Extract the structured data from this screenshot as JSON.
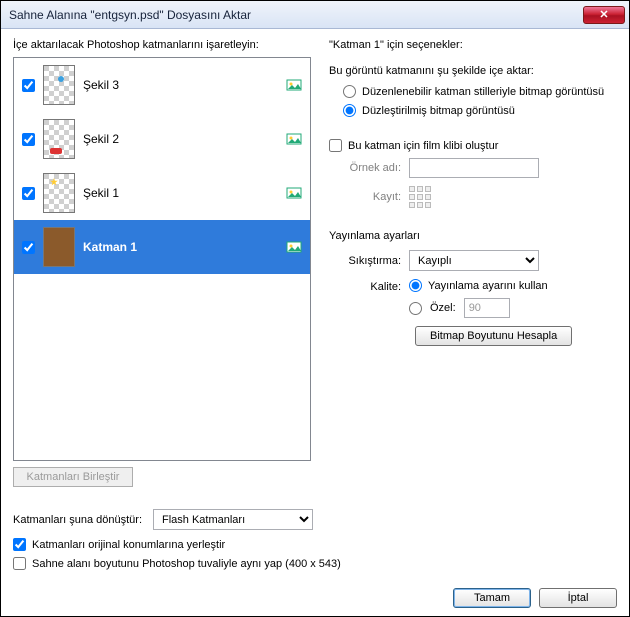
{
  "title": "Sahne Alanına \"entgsyn.psd\" Dosyasını Aktar",
  "left": {
    "heading": "İçe aktarılacak Photoshop katmanlarını işaretleyin:",
    "layers": [
      {
        "name": "Şekil 3",
        "checked": true,
        "selected": false
      },
      {
        "name": "Şekil 2",
        "checked": true,
        "selected": false
      },
      {
        "name": "Şekil 1",
        "checked": true,
        "selected": false
      },
      {
        "name": "Katman 1",
        "checked": true,
        "selected": true
      }
    ],
    "merge_btn": "Katmanları Birleştir"
  },
  "right": {
    "options_for": "\"Katman 1\" için seçenekler:",
    "import_as": {
      "heading": "Bu görüntü katmanını şu şekilde içe aktar:",
      "opt_editable": "Düzenlenebilir katman stilleriyle bitmap görüntüsü",
      "opt_flat": "Düzleştirilmiş bitmap görüntüsü",
      "selected": "flat"
    },
    "movieclip": {
      "label": "Bu katman için film klibi oluştur",
      "checked": false,
      "instance_label": "Örnek adı:",
      "instance_value": "",
      "reg_label": "Kayıt:"
    },
    "publish": {
      "heading": "Yayınlama ayarları",
      "compress_label": "Sıkıştırma:",
      "compress_value": "Kayıplı",
      "quality_label": "Kalite:",
      "quality_opt_pub": "Yayınlama ayarını kullan",
      "quality_opt_custom": "Özel:",
      "quality_custom_value": "90",
      "quality_selected": "publish",
      "calc_btn": "Bitmap Boyutunu Hesapla"
    }
  },
  "bottom": {
    "convert_label": "Katmanları şuna dönüştür:",
    "convert_value": "Flash Katmanları",
    "chk_place": {
      "label": "Katmanları orijinal konumlarına yerleştir",
      "checked": true
    },
    "chk_stage": {
      "label": "Sahne alanı boyutunu Photoshop tuvaliyle aynı yap (400 x 543)",
      "checked": false
    }
  },
  "ok": "Tamam",
  "cancel": "İptal"
}
